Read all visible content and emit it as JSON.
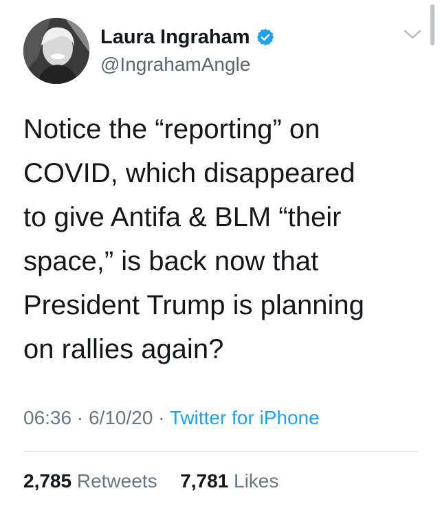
{
  "author": {
    "display_name": "Laura Ingraham",
    "handle": "@IngrahamAngle",
    "verified": true,
    "avatar_icon": "profile-photo"
  },
  "tweet": {
    "text": "Notice the “reporting” on\nCOVID, which disappeared\nto give Antifa & BLM “their\nspace,” is back now that\nPresident Trump is planning\non rallies again?",
    "time": "06:36",
    "date": "6/10/20",
    "separator": "·",
    "source": "Twitter for iPhone"
  },
  "stats": {
    "retweets_count": "2,785",
    "retweets_label": "Retweets",
    "likes_count": "7,781",
    "likes_label": "Likes"
  },
  "icons": {
    "verified": "verified-badge-icon",
    "menu": "chevron-down-icon"
  },
  "colors": {
    "link": "#1da1f2",
    "verified": "#1da1f2",
    "secondary_text": "#657786",
    "primary_text": "#14171a"
  }
}
